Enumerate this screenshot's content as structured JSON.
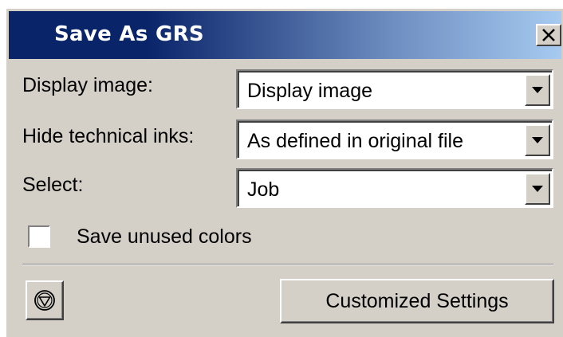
{
  "window": {
    "title": "Save As GRS",
    "close_icon": "close-x-icon"
  },
  "fields": {
    "display_image": {
      "label": "Display image:",
      "value": "Display image"
    },
    "hide_technical_inks": {
      "label": "Hide technical inks:",
      "value": "As defined in original file"
    },
    "select": {
      "label": "Select:",
      "value": "Job"
    }
  },
  "save_unused_colors": {
    "label": "Save unused colors",
    "checked": false
  },
  "buttons": {
    "icon_button_icon": "triangle-in-circle-icon",
    "customized_settings": "Customized Settings"
  }
}
